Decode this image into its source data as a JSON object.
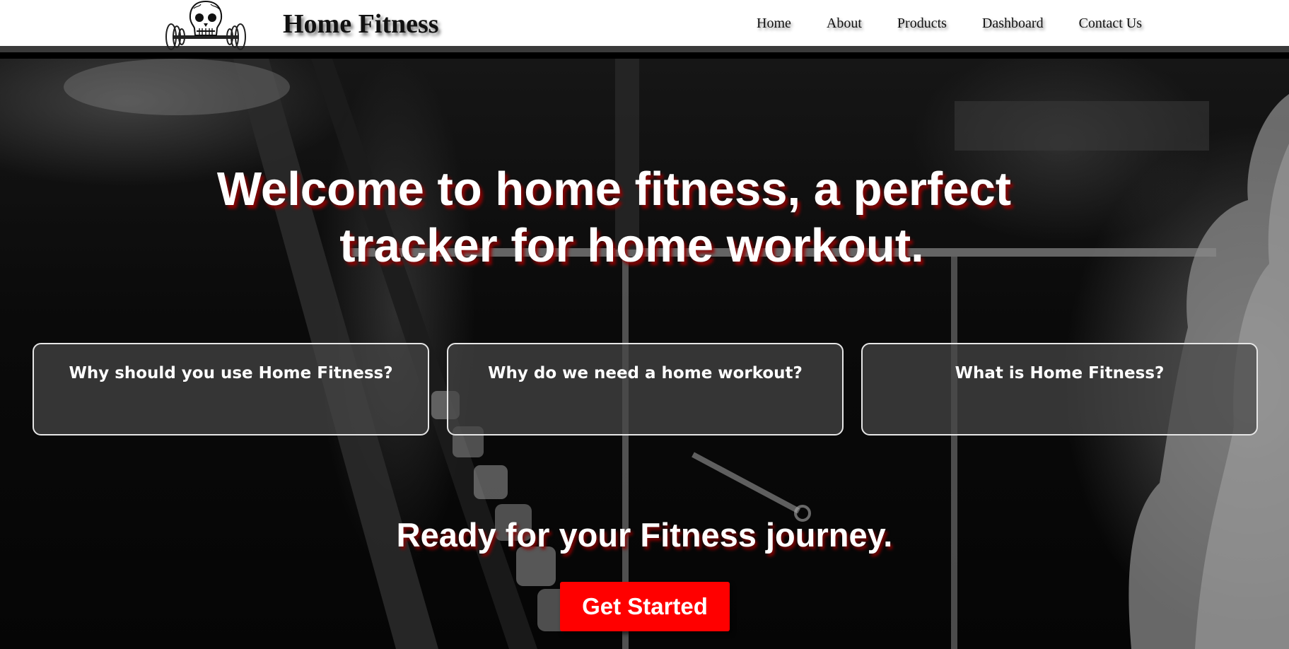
{
  "brand": {
    "name": "Home Fitness",
    "logo_icon": "skull-barbell-icon"
  },
  "nav": {
    "items": [
      {
        "label": "Home"
      },
      {
        "label": "About"
      },
      {
        "label": "Products"
      },
      {
        "label": "Dashboard"
      },
      {
        "label": "Contact Us"
      }
    ]
  },
  "hero": {
    "headline_line1": "Welcome to home fitness, a perfect",
    "headline_line2": "tracker for home workout.",
    "cards": [
      {
        "title": "Why should you use Home Fitness?"
      },
      {
        "title": "Why do we need a home workout?"
      },
      {
        "title": "What is Home Fitness?"
      }
    ],
    "subheadline": "Ready for your Fitness journey.",
    "cta_label": "Get Started"
  },
  "colors": {
    "navbar_bg": "#ffffff",
    "navbar_border": "#3a3a3a",
    "cta_bg": "#ff0000",
    "text_shadow_accent": "#960000",
    "card_border": "#e6e6e6"
  }
}
